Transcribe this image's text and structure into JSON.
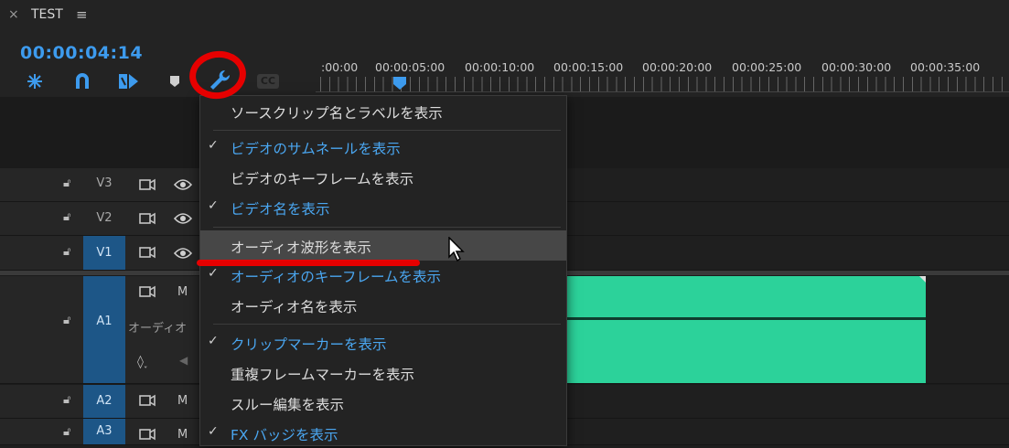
{
  "window": {
    "title": "TEST",
    "close": "×",
    "menu": "≡"
  },
  "timecode": "00:00:04:14",
  "cc_label": "CC",
  "ruler": {
    "ticks": [
      ":00:00",
      "00:00:05:00",
      "00:00:10:00",
      "00:00:15:00",
      "00:00:20:00",
      "00:00:25:00",
      "00:00:30:00",
      "00:00:35:00"
    ]
  },
  "tracks": {
    "v3": "V3",
    "v2": "V2",
    "v1": "V1",
    "a1": "A1",
    "a2": "A2",
    "a3": "A3",
    "m": "M",
    "audio_name_partial": "オーディオ"
  },
  "menu": {
    "items": [
      {
        "label": "ソースクリップ名とラベルを表示",
        "checked": false
      },
      {
        "label": "ビデオのサムネールを表示",
        "checked": true
      },
      {
        "label": "ビデオのキーフレームを表示",
        "checked": false
      },
      {
        "label": "ビデオ名を表示",
        "checked": true
      },
      {
        "label": "オーディオ波形を表示",
        "checked": false,
        "highlighted": true
      },
      {
        "label": "オーディオのキーフレームを表示",
        "checked": true
      },
      {
        "label": "オーディオ名を表示",
        "checked": false
      },
      {
        "label": "クリップマーカーを表示",
        "checked": true
      },
      {
        "label": "重複フレームマーカーを表示",
        "checked": false
      },
      {
        "label": "スルー編集を表示",
        "checked": false
      },
      {
        "label": "FX バッジを表示",
        "checked": true
      }
    ],
    "check_glyph": "✓"
  },
  "colors": {
    "accent_blue": "#3d9bee",
    "clip_green": "#2cd29a",
    "annotation_red": "#e60000"
  },
  "icons": [
    "close-icon",
    "hamburger-menu-icon",
    "snap-icon",
    "linked-selection-icon",
    "add-marker-icon",
    "marker-icon",
    "wrench-icon",
    "captions-icon",
    "lock-icon",
    "toggle-sync-icon",
    "eye-icon",
    "mouse-cursor-icon"
  ]
}
